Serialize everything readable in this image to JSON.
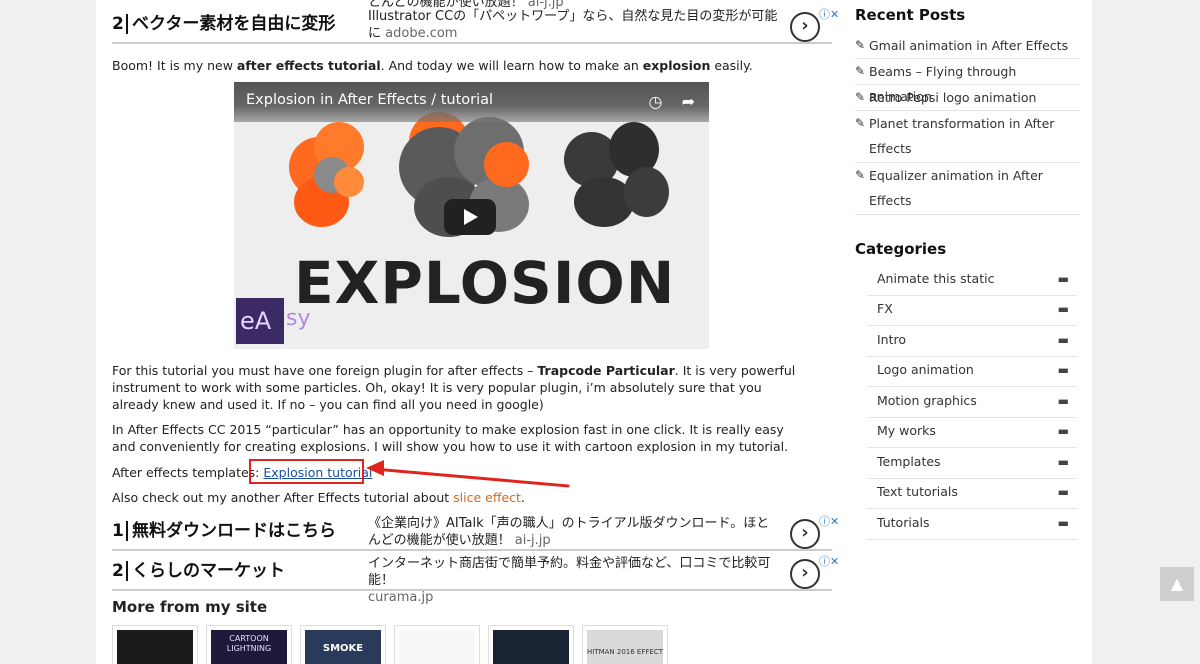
{
  "ads": [
    {
      "num": "2",
      "title": "ベクター素材を自由に変形",
      "desc": "Illustrator CCの「パペットワープ」なら、自然な見た目の変形が可能に",
      "domain": "adobe.com",
      "top_text": "とんどの機能が使い放題！",
      "top_domain": "ai-j.jp"
    },
    {
      "num": "1",
      "title": "無料ダウンロードはこちら",
      "desc": "《企業向け》AITalk「声の職人」のトライアル版ダウンロード。ほとんどの機能が使い放題！",
      "domain": "ai-j.jp"
    },
    {
      "num": "2",
      "title": "くらしのマーケット",
      "desc": "インターネット商店街で簡単予約。料金や評価など、口コミで比較可能！",
      "domain": "curama.jp"
    }
  ],
  "ad_go": "›",
  "ad_x": "ⓘ✕",
  "intro": {
    "pre": "Boom! It is my new ",
    "b1": "after effects tutorial",
    "mid": ". And today we will learn how to make an ",
    "b2": "explosion",
    "post": " easily."
  },
  "video": {
    "title": "Explosion in After Effects / tutorial",
    "big_text": "EXPLOSION",
    "logo_a": "eA",
    "logo_b": "sy",
    "clock": "◷",
    "share": "➦"
  },
  "para1": {
    "pre": "For this tutorial you must have one foreign plugin for after effects – ",
    "b": "Trapcode Particular",
    "post": ". It is very powerful instrument to work with some particles. Oh, okay! It is very popular plugin, i’m absolutely sure that you already knew and used it. If no – you can find all you need in google)"
  },
  "para2": "In After Effects CC 2015 “particular” has an opportunity to make explosion fast in one click. It is really easy and conveniently for creating explosions. I will show you how to use it with cartoon explosion in my tutorial.",
  "templates": {
    "label": "After effects templates: ",
    "link": "Explosion tutorial"
  },
  "also": {
    "pre": "Also check out my another After Effects tutorial about ",
    "link": "slice effect",
    "post": "."
  },
  "more_title": "More from my site",
  "thumbs": [
    "",
    "CARTOON LIGHTNING",
    "SMOKE",
    "",
    "",
    "HITMAN 2016 EFFECT"
  ],
  "sidebar": {
    "recent_title": "Recent Posts",
    "recent": [
      [
        "Gmail animation in After Effects"
      ],
      [
        "Beams – Flying through animation"
      ],
      [
        "Retro Pepsi logo animation"
      ],
      [
        "Planet transformation in After",
        "Effects"
      ],
      [
        "Equalizer animation in After",
        "Effects"
      ]
    ],
    "cat_title": "Categories",
    "categories": [
      "Animate this static",
      "FX",
      "Intro",
      "Logo animation",
      "Motion graphics",
      "My works",
      "Templates",
      "Text tutorials",
      "Tutorials"
    ]
  },
  "to_top": "▲",
  "colors": {
    "accent_link": "#1a4fa3",
    "orange_link": "#d2691e",
    "annotation": "#e0231c"
  }
}
